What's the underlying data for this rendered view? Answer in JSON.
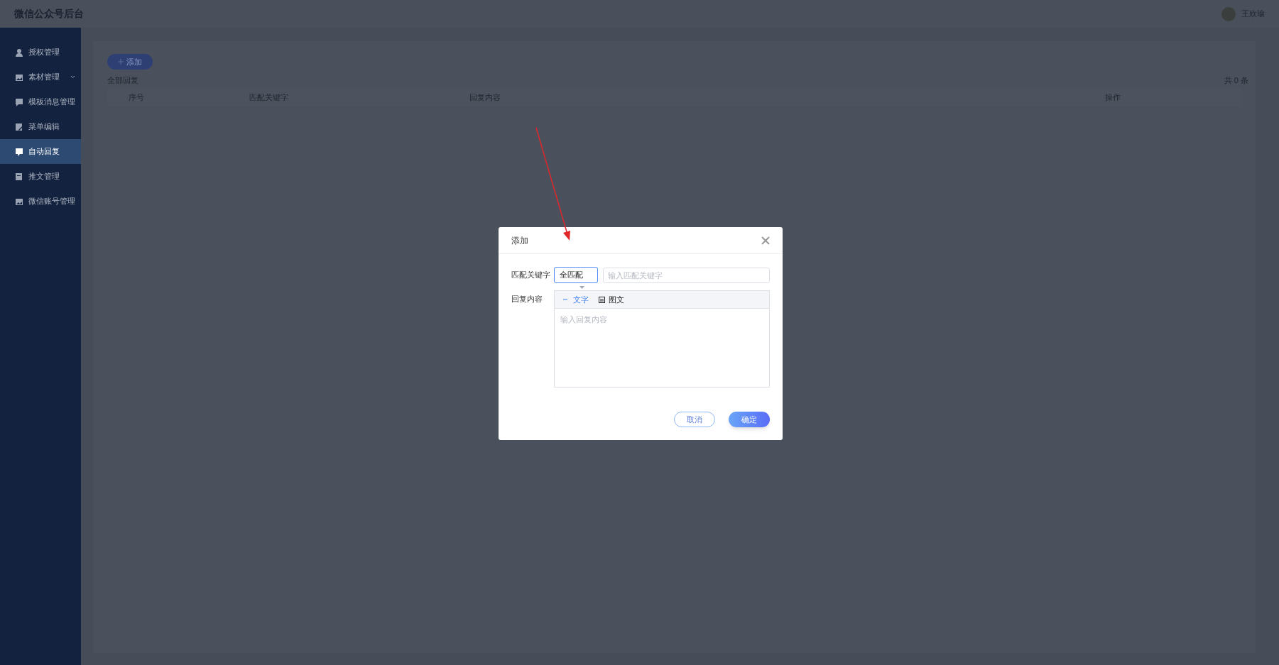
{
  "header": {
    "title": "微信公众号后台",
    "user": {
      "name": "王欣瑜"
    }
  },
  "sidebar": {
    "items": [
      {
        "label": "授权管理",
        "expandable": false,
        "selected": false
      },
      {
        "label": "素材管理",
        "expandable": true,
        "selected": false
      },
      {
        "label": "模板消息管理",
        "expandable": false,
        "selected": false
      },
      {
        "label": "菜单编辑",
        "expandable": false,
        "selected": false
      },
      {
        "label": "自动回复",
        "expandable": false,
        "selected": true
      },
      {
        "label": "推文管理",
        "expandable": false,
        "selected": false
      },
      {
        "label": "微信账号管理",
        "expandable": false,
        "selected": false
      }
    ]
  },
  "content": {
    "add_button": "添加",
    "section_title": "全部回复",
    "total": "共 0 条",
    "table": {
      "columns": [
        "序号",
        "匹配关键字",
        "回复内容",
        "操作"
      ]
    }
  },
  "dialog": {
    "title": "添加",
    "keyword": {
      "label": "匹配关键字",
      "match_mode": "全匹配",
      "placeholder": "输入匹配关键字"
    },
    "reply": {
      "label": "回复内容",
      "tabs": [
        {
          "label": "文字",
          "kind": "text",
          "selected": true
        },
        {
          "label": "图文",
          "kind": "news",
          "selected": false
        }
      ],
      "placeholder": "输入回复内容"
    },
    "buttons": [
      {
        "label": "取消",
        "kind": "secondary"
      },
      {
        "label": "确定",
        "kind": "primary"
      }
    ]
  }
}
